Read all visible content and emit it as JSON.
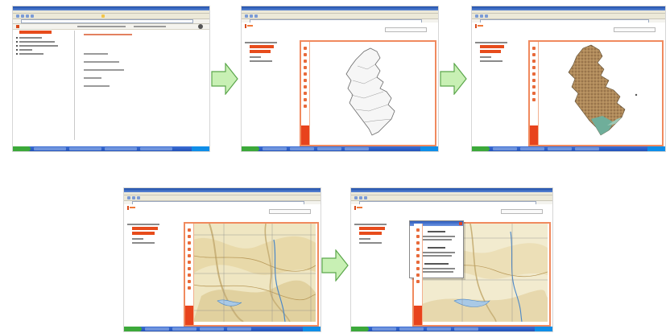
{
  "figure": {
    "panels": [
      {
        "id": "panel-1-portal-home",
        "window": "browser-window",
        "content": "portal-home-tree"
      },
      {
        "id": "panel-2-map-outline",
        "window": "browser-window",
        "content": "map-region-outline"
      },
      {
        "id": "panel-3-map-thematic",
        "window": "browser-window",
        "content": "map-region-thematic"
      },
      {
        "id": "panel-4-map-zoomed",
        "window": "browser-window",
        "content": "map-topographic-zoom"
      },
      {
        "id": "panel-5-map-info-popup",
        "window": "browser-window",
        "content": "map-topographic-popup"
      }
    ],
    "arrows": [
      {
        "from": "panel-1-portal-home",
        "to": "panel-2-map-outline",
        "direction": "right"
      },
      {
        "from": "panel-2-map-outline",
        "to": "panel-3-map-thematic",
        "direction": "right"
      },
      {
        "from": "panel-4-map-zoomed",
        "to": "panel-5-map-info-popup",
        "direction": "right"
      }
    ]
  },
  "colors": {
    "arrow_fill": "#c8f0b4",
    "arrow_stroke": "#5aa64a",
    "map_border": "#f08a5e",
    "accent_orange": "#e8431c",
    "map_land_thematic": "#b08a5a",
    "map_coast_thematic": "#6fae9a",
    "topo_base": "#efe6c2",
    "topo_relief": "#c9b27a",
    "topo_river": "#4a87c8"
  },
  "icons": [
    "arrow-right-icon",
    "close-icon",
    "start-button-icon",
    "zoom-tool-icon",
    "pan-tool-icon",
    "info-tool-icon"
  ]
}
